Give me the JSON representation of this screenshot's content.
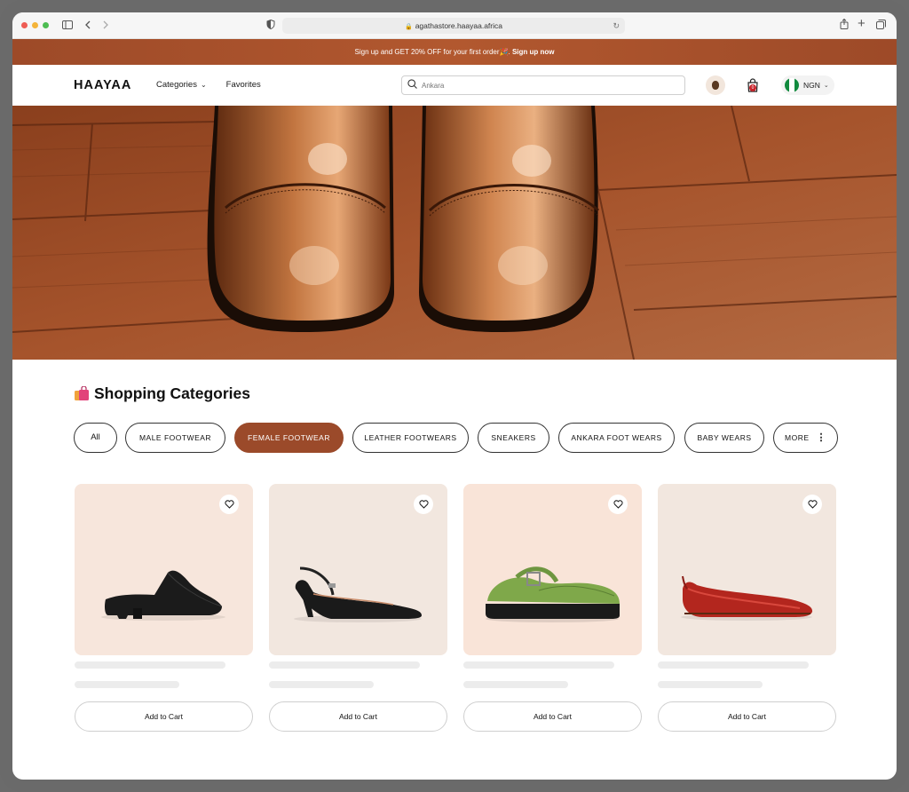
{
  "browser": {
    "url": "agathastore.haayaa.africa"
  },
  "promo": {
    "text": "Sign up and GET 20% OFF for your first order",
    "emoji": "🎉",
    "cta": "Sign up now"
  },
  "header": {
    "logo": "HAAYAA",
    "nav": [
      {
        "label": "Categories"
      },
      {
        "label": "Favorites"
      }
    ],
    "search_value": "Ankara",
    "cart_count": "0",
    "currency": "NGN"
  },
  "categories": {
    "title": "Shopping Categories",
    "pills": [
      {
        "label": "All"
      },
      {
        "label": "MALE FOOTWEAR"
      },
      {
        "label": "FEMALE FOOTWEAR"
      },
      {
        "label": "LEATHER FOOTWEARS"
      },
      {
        "label": "SNEAKERS"
      },
      {
        "label": "ANKARA FOOT WEARS"
      },
      {
        "label": "BABY WEARS"
      },
      {
        "label": "MORE"
      }
    ],
    "active": "FEMALE FOOTWEAR"
  },
  "products": [
    {
      "image": "black-mule-image",
      "bg": "#f7e6dc",
      "button": "Add to Cart"
    },
    {
      "image": "black-slingback-heel-image",
      "bg": "#f2e7df",
      "button": "Add to Cart"
    },
    {
      "image": "green-mary-jane-loafer-image",
      "bg": "#f9e4d8",
      "button": "Add to Cart"
    },
    {
      "image": "red-ballet-flat-image",
      "bg": "#f2e7df",
      "button": "Add to Cart"
    }
  ],
  "colors": {
    "brand": "#9b4a2a",
    "promo_bg": "#a6502b"
  }
}
